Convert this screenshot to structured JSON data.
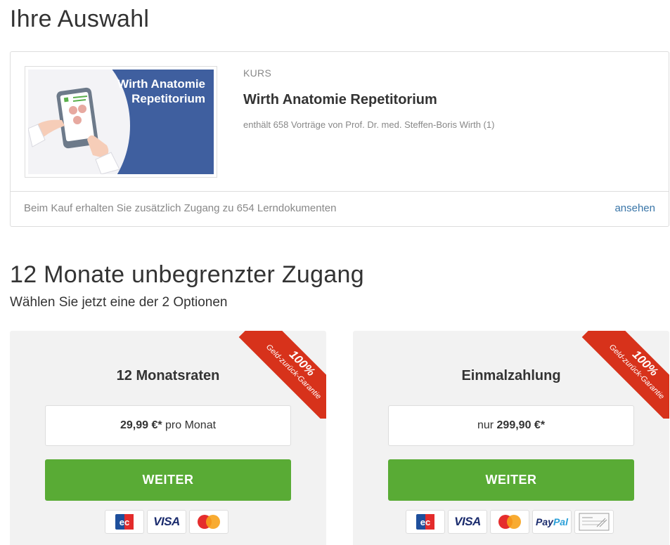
{
  "selection": {
    "heading": "Ihre Auswahl",
    "thumbnail_title": "Wirth Anatomie Repetitorium",
    "type_label": "KURS",
    "title": "Wirth Anatomie Repetitorium",
    "subtitle": "enthält 658 Vorträge von Prof. Dr. med. Steffen-Boris Wirth (1)",
    "footer_info": "Beim Kauf erhalten Sie zusätzlich Zugang zu 654 Lerndokumenten",
    "footer_link": "ansehen"
  },
  "access": {
    "heading": "12 Monate unbegrenzter Zugang",
    "subheading": "Wählen Sie jetzt eine der 2 Optionen"
  },
  "options": [
    {
      "title": "12 Monatsraten",
      "price_prefix": "",
      "price": "29,99 €*",
      "price_suffix": " pro Monat",
      "button_label": "WEITER",
      "ribbon_percent": "100%",
      "ribbon_text": "Geld-zurück-Garantie",
      "payment_methods": [
        "ec-icon",
        "visa-icon",
        "mastercard-icon"
      ]
    },
    {
      "title": "Einmalzahlung",
      "price_prefix": "nur ",
      "price": "299,90 €*",
      "price_suffix": "",
      "button_label": "WEITER",
      "ribbon_percent": "100%",
      "ribbon_text": "Geld-zurück-Garantie",
      "payment_methods": [
        "ec-icon",
        "visa-icon",
        "mastercard-icon",
        "paypal-icon",
        "invoice-icon"
      ]
    }
  ],
  "labels": {
    "visa": "VISA",
    "paypal_pay": "Pay",
    "paypal_pal": "Pal"
  },
  "colors": {
    "accent_green": "#59ab35",
    "ribbon_red": "#d7321b",
    "link_blue": "#3a76a8",
    "thumbnail_blue": "#3f5f9f"
  }
}
